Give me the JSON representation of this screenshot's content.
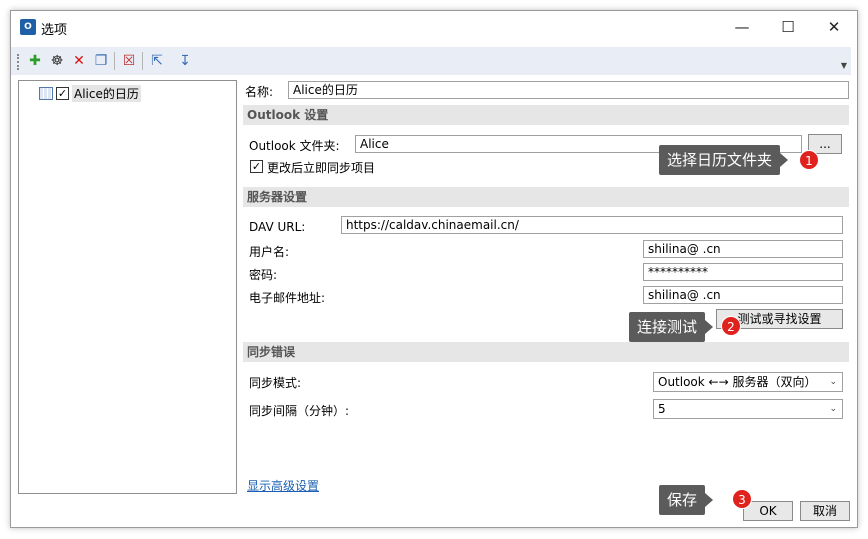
{
  "window": {
    "title": "选项",
    "app_icon": "outlook-icon"
  },
  "tree": {
    "item": {
      "label": "Alice的日历",
      "checked": "✓"
    }
  },
  "form": {
    "name_label": "名称:",
    "name_value": "Alice的日历",
    "outlook_section": "Outlook 设置",
    "outlook_folder_label": "Outlook 文件夹:",
    "outlook_folder_value": "Alice",
    "browse_label": "...",
    "sync_immediately_label": "更改后立即同步项目",
    "sync_immediately_checked": "✓",
    "server_section": "服务器设置",
    "dav_url_label": "DAV URL:",
    "dav_url_value": "https://caldav.chinaemail.cn/",
    "username_label": "用户名:",
    "username_value": "shilina@      .cn",
    "password_label": "密码:",
    "password_value": "**********",
    "email_label": "电子邮件地址:",
    "email_value": "shilina@      .cn",
    "test_button": "测试或寻找设置",
    "sync_errors_section": "同步错误",
    "sync_mode_label": "同步模式:",
    "sync_mode_value": "Outlook ←→ 服务器（双向）",
    "sync_interval_label": "同步间隔（分钟）:",
    "sync_interval_value": "5",
    "advanced_link": "显示高级设置",
    "ok_button": "OK",
    "cancel_button": "取消"
  },
  "callouts": {
    "c1": {
      "text": "选择日历文件夹",
      "num": "1"
    },
    "c2": {
      "text": "连接测试",
      "num": "2"
    },
    "c3": {
      "text": "保存",
      "num": "3"
    }
  },
  "colors": {
    "accent": "#1a5fb4",
    "badge": "#e0221e",
    "callout": "#5b5b5b"
  }
}
